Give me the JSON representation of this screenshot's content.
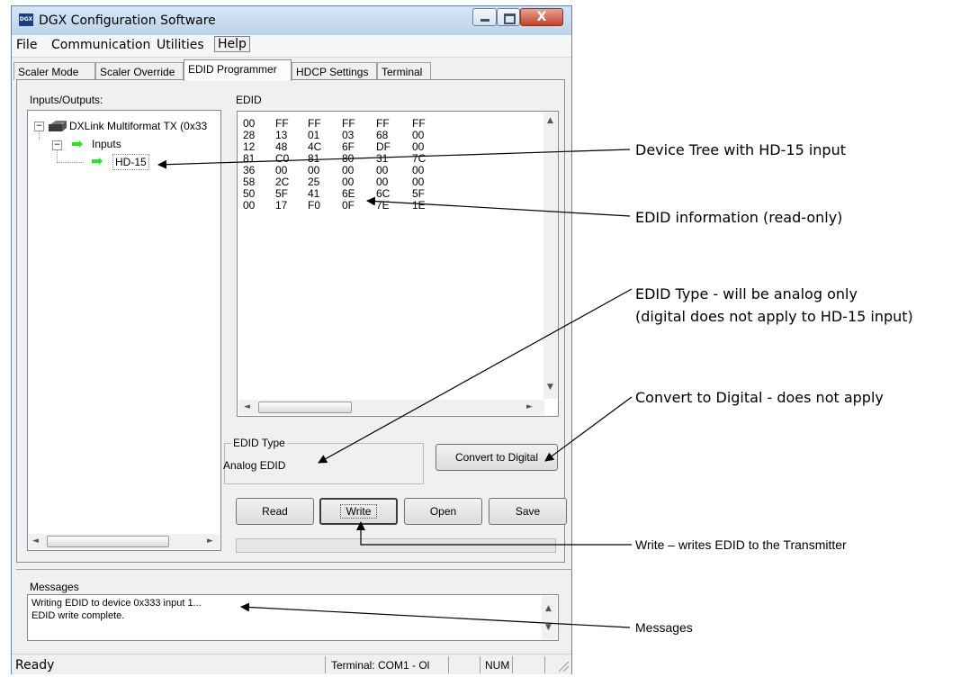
{
  "window": {
    "title": "DGX Configuration Software",
    "app_icon_text": "DGX",
    "close_glyph": "X"
  },
  "menu": {
    "file": "File",
    "communication": "Communication",
    "utilities": "Utilities",
    "help": "Help"
  },
  "tabs": [
    {
      "label": "Scaler Mode"
    },
    {
      "label": "Scaler Override"
    },
    {
      "label": "EDID Programmer"
    },
    {
      "label": "HDCP Settings"
    },
    {
      "label": "Terminal"
    }
  ],
  "labels": {
    "inputs_outputs": "Inputs/Outputs:",
    "edid": "EDID"
  },
  "tree": {
    "device": "DXLink Multiformat TX (0x33",
    "inputs": "Inputs",
    "hd15": "HD-15"
  },
  "edid_hex": [
    [
      "00",
      "FF",
      "FF",
      "FF",
      "FF",
      "FF"
    ],
    [
      "28",
      "13",
      "01",
      "03",
      "68",
      "00"
    ],
    [
      "12",
      "48",
      "4C",
      "6F",
      "DF",
      "00"
    ],
    [
      "81",
      "C0",
      "81",
      "80",
      "31",
      "7C"
    ],
    [
      "36",
      "00",
      "00",
      "00",
      "00",
      "00"
    ],
    [
      "58",
      "2C",
      "25",
      "00",
      "00",
      "00"
    ],
    [
      "50",
      "5F",
      "41",
      "6E",
      "6C",
      "5F"
    ],
    [
      "00",
      "17",
      "F0",
      "0F",
      "7E",
      "1E"
    ]
  ],
  "edid_type": {
    "legend": "EDID Type",
    "value": "Analog EDID"
  },
  "buttons": {
    "convert": "Convert to Digital",
    "read": "Read",
    "write": "Write",
    "open": "Open",
    "save": "Save"
  },
  "messages": {
    "label": "Messages",
    "lines": [
      "Writing EDID to device 0x333 input 1...",
      "EDID write complete."
    ]
  },
  "status": {
    "ready": "Ready",
    "terminal": "Terminal: COM1 - Ol",
    "num": "NUM"
  },
  "annotations": {
    "device_tree": "Device Tree with HD-15 input",
    "edid_info": "EDID information (read-only)",
    "edid_type_1": "EDID Type - will be analog only",
    "edid_type_2": "(digital does not apply to HD-15 input)",
    "convert": "Convert to Digital - does not apply",
    "write": "Write – writes EDID to the Transmitter",
    "messages": "Messages"
  },
  "colors": {
    "arrow_green": "#2ee02e",
    "titlebar": "#c9dcf0",
    "close_red": "#c4412a"
  }
}
